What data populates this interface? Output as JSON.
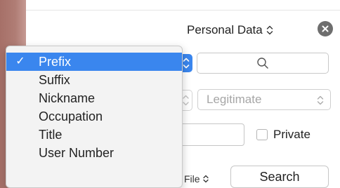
{
  "header": {
    "popup_label": "Personal Data",
    "close_icon": "close-icon"
  },
  "form": {
    "search_icon": "magnifier-icon",
    "legitimacy_value": "Legitimate",
    "text_field_value": "",
    "private_label": "Private",
    "private_checked": false,
    "file_popup_label": "File",
    "search_button_label": "Search"
  },
  "menu": {
    "check_mark": "✓",
    "selected_index": 0,
    "items": [
      {
        "label": "Prefix"
      },
      {
        "label": "Suffix"
      },
      {
        "label": "Nickname"
      },
      {
        "label": "Occupation"
      },
      {
        "label": "Title"
      },
      {
        "label": "User Number"
      }
    ]
  },
  "colors": {
    "accent": "#3a86ee",
    "menu_background": "#f3f3f3",
    "placeholder_text": "#a6a6a6"
  }
}
